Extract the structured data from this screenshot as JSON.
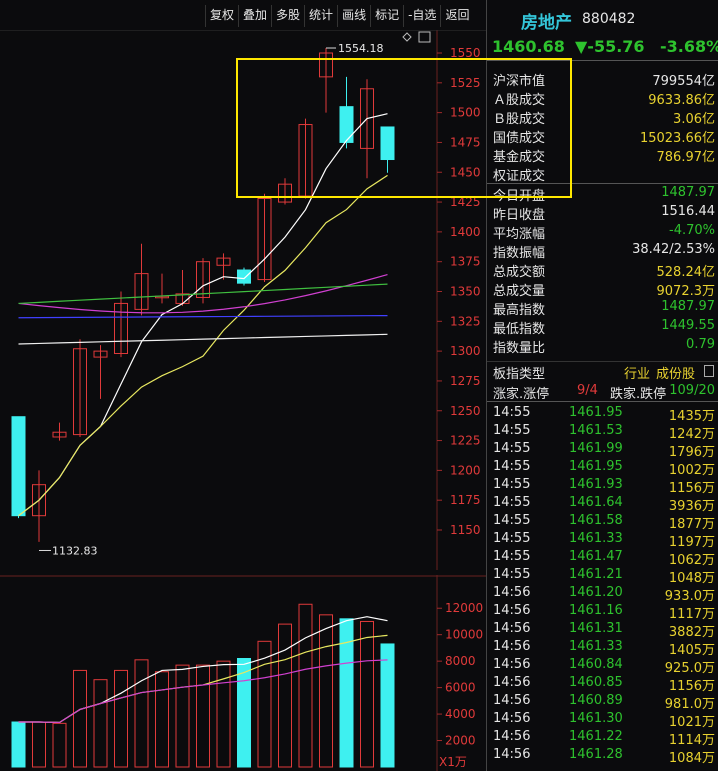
{
  "toolbar": [
    "复权",
    "叠加",
    "多股",
    "统计",
    "画线",
    "标记",
    "-自选",
    "返回"
  ],
  "chart": {
    "high_label": "1554.18",
    "low_label": "1132.83",
    "price_ticks": [
      "1550",
      "1525",
      "1500",
      "1475",
      "1450",
      "1425",
      "1400",
      "1375",
      "1350",
      "1325",
      "1300",
      "1275",
      "1250",
      "1225",
      "1200",
      "1175",
      "1150"
    ],
    "vol_ticks": [
      "12000",
      "10000",
      "8000",
      "6000",
      "4000",
      "2000"
    ],
    "vol_unit": "X1万",
    "colors": {
      "up": "#e03a3a",
      "down": "#3ef0f0",
      "ma5": "#ffffff",
      "ma10": "#e8e860",
      "ma20": "#d040d0",
      "ma30": "#40c040",
      "ma60": "#4040ff"
    }
  },
  "chart_data": {
    "type": "candlestick",
    "candles": [
      {
        "o": 1245,
        "c": 1162,
        "h": 1245,
        "l": 1160
      },
      {
        "o": 1162,
        "c": 1188,
        "h": 1200,
        "l": 1140
      },
      {
        "o": 1228,
        "c": 1232,
        "h": 1240,
        "l": 1225
      },
      {
        "o": 1230,
        "c": 1302,
        "h": 1310,
        "l": 1228
      },
      {
        "o": 1295,
        "c": 1300,
        "h": 1305,
        "l": 1260
      },
      {
        "o": 1298,
        "c": 1340,
        "h": 1350,
        "l": 1295
      },
      {
        "o": 1335,
        "c": 1365,
        "h": 1390,
        "l": 1330
      },
      {
        "o": 1345,
        "c": 1346,
        "h": 1365,
        "l": 1340
      },
      {
        "o": 1340,
        "c": 1348,
        "h": 1368,
        "l": 1338
      },
      {
        "o": 1345,
        "c": 1375,
        "h": 1378,
        "l": 1340
      },
      {
        "o": 1372,
        "c": 1378,
        "h": 1382,
        "l": 1360
      },
      {
        "o": 1368,
        "c": 1357,
        "h": 1370,
        "l": 1355
      },
      {
        "o": 1360,
        "c": 1428,
        "h": 1432,
        "l": 1358
      },
      {
        "o": 1425,
        "c": 1440,
        "h": 1445,
        "l": 1423
      },
      {
        "o": 1430,
        "c": 1490,
        "h": 1495,
        "l": 1428
      },
      {
        "o": 1530,
        "c": 1550,
        "h": 1554.18,
        "l": 1500
      },
      {
        "o": 1505,
        "c": 1475,
        "h": 1530,
        "l": 1470
      },
      {
        "o": 1470,
        "c": 1520,
        "h": 1528,
        "l": 1445
      },
      {
        "o": 1487.97,
        "c": 1460.68,
        "h": 1487.97,
        "l": 1449.55
      }
    ],
    "volumes": [
      3400,
      3400,
      3300,
      7300,
      6600,
      7300,
      8100,
      7200,
      7700,
      7700,
      8000,
      8200,
      9500,
      10800,
      12300,
      11500,
      11200,
      11000,
      9300
    ],
    "ylim": [
      1130,
      1560
    ],
    "vol_ylim": [
      0,
      13000
    ]
  },
  "side": {
    "name": "房地产",
    "code": "880482",
    "price": "1460.68",
    "change": "▼-55.76",
    "pct": "-3.68%",
    "stats": [
      {
        "label": "沪深市值",
        "value": "799554亿",
        "color": "white"
      },
      {
        "label": "Ａ股成交",
        "value": "9633.86亿",
        "color": "yellow"
      },
      {
        "label": "Ｂ股成交",
        "value": "3.06亿",
        "color": "yellow"
      },
      {
        "label": "国债成交",
        "value": "15023.66亿",
        "color": "yellow"
      },
      {
        "label": "基金成交",
        "value": "786.97亿",
        "color": "yellow"
      },
      {
        "label": "权证成交",
        "value": "",
        "color": "yellow"
      },
      {
        "label": "今日开盘",
        "value": "1487.97",
        "color": "green"
      },
      {
        "label": "昨日收盘",
        "value": "1516.44",
        "color": "white"
      },
      {
        "label": "平均涨幅",
        "value": "-4.70%",
        "color": "green"
      },
      {
        "label": "指数振幅",
        "value": "38.42/2.53%",
        "color": "white"
      },
      {
        "label": "总成交额",
        "value": "528.24亿",
        "color": "yellow"
      },
      {
        "label": "总成交量",
        "value": "9072.3万",
        "color": "yellow"
      },
      {
        "label": "最高指数",
        "value": "1487.97",
        "color": "green"
      },
      {
        "label": "最低指数",
        "value": "1449.55",
        "color": "green"
      },
      {
        "label": "指数量比",
        "value": "0.79",
        "color": "green"
      }
    ],
    "board_label": "板指类型",
    "board_type": "行业",
    "board_link": "成份股",
    "up_label": "涨家.涨停",
    "up_value": "9/4",
    "down_label": "跌家.跌停",
    "down_value": "109/20",
    "ticks": [
      {
        "t": "14:55",
        "p": "1461.95",
        "v": "1435万"
      },
      {
        "t": "14:55",
        "p": "1461.53",
        "v": "1242万"
      },
      {
        "t": "14:55",
        "p": "1461.99",
        "v": "1796万"
      },
      {
        "t": "14:55",
        "p": "1461.95",
        "v": "1002万"
      },
      {
        "t": "14:55",
        "p": "1461.93",
        "v": "1156万"
      },
      {
        "t": "14:55",
        "p": "1461.64",
        "v": "3936万"
      },
      {
        "t": "14:55",
        "p": "1461.58",
        "v": "1877万"
      },
      {
        "t": "14:55",
        "p": "1461.33",
        "v": "1197万"
      },
      {
        "t": "14:55",
        "p": "1461.47",
        "v": "1062万"
      },
      {
        "t": "14:55",
        "p": "1461.21",
        "v": "1048万"
      },
      {
        "t": "14:56",
        "p": "1461.20",
        "v": "933.0万"
      },
      {
        "t": "14:56",
        "p": "1461.16",
        "v": "1117万"
      },
      {
        "t": "14:56",
        "p": "1461.31",
        "v": "3882万"
      },
      {
        "t": "14:56",
        "p": "1461.33",
        "v": "1405万"
      },
      {
        "t": "14:56",
        "p": "1460.84",
        "v": "925.0万"
      },
      {
        "t": "14:56",
        "p": "1460.85",
        "v": "1156万"
      },
      {
        "t": "14:56",
        "p": "1460.89",
        "v": "981.0万"
      },
      {
        "t": "14:56",
        "p": "1461.30",
        "v": "1021万"
      },
      {
        "t": "14:56",
        "p": "1461.22",
        "v": "1114万"
      },
      {
        "t": "14:56",
        "p": "1461.28",
        "v": "1084万"
      }
    ]
  }
}
